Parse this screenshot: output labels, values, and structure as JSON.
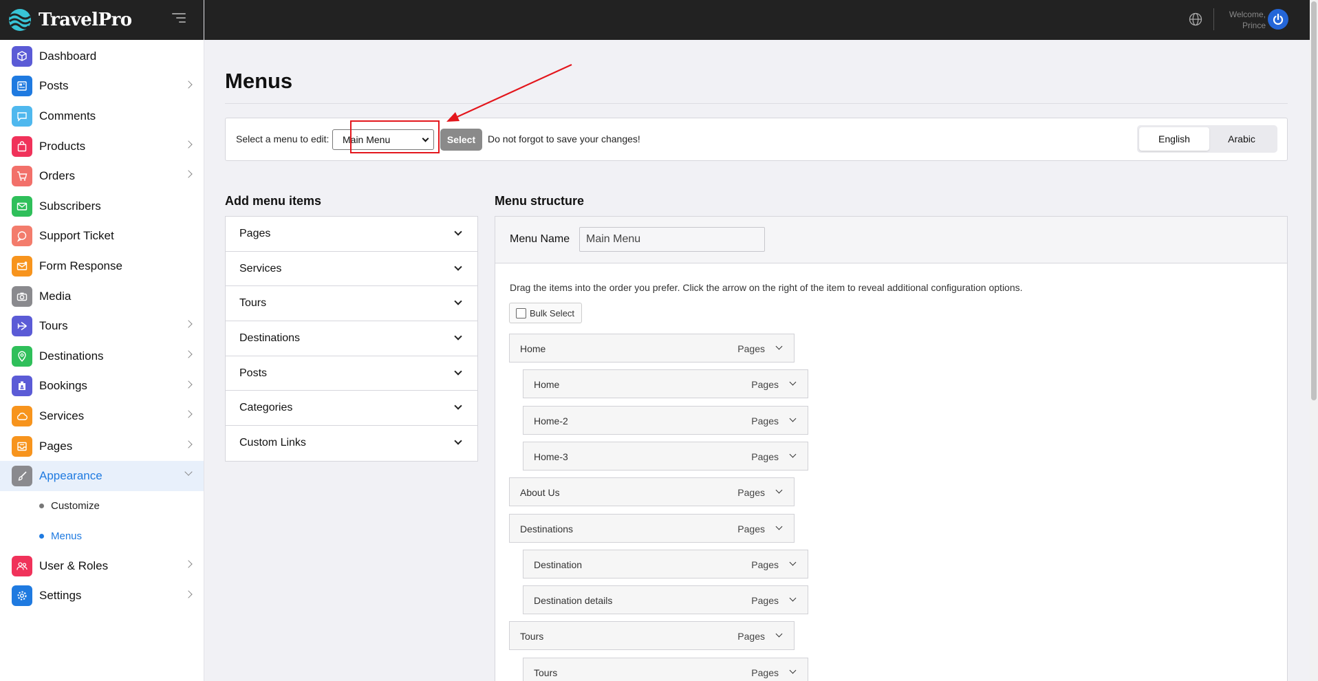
{
  "brand": {
    "name": "TravelPro"
  },
  "sidebar": {
    "items": [
      {
        "label": "Dashboard",
        "icon": "cube-icon",
        "color": "#5b5bd6",
        "chevron": false
      },
      {
        "label": "Posts",
        "icon": "newspaper-icon",
        "color": "#1f7ae0",
        "chevron": true
      },
      {
        "label": "Comments",
        "icon": "comment-icon",
        "color": "#4fb8ee",
        "chevron": false
      },
      {
        "label": "Products",
        "icon": "shopping-bag-icon",
        "color": "#f0325a",
        "chevron": true
      },
      {
        "label": "Orders",
        "icon": "cart-icon",
        "color": "#f2706a",
        "chevron": true
      },
      {
        "label": "Subscribers",
        "icon": "mail-icon",
        "color": "#2fbf5a",
        "chevron": false
      },
      {
        "label": "Support Ticket",
        "icon": "chat-bubble-icon",
        "color": "#f37c6c",
        "chevron": false
      },
      {
        "label": "Form Response",
        "icon": "envelope-icon",
        "color": "#f7941d",
        "chevron": false
      },
      {
        "label": "Media",
        "icon": "camera-icon",
        "color": "#8a8a8e",
        "chevron": false
      },
      {
        "label": "Tours",
        "icon": "plane-icon",
        "color": "#5b5bd6",
        "chevron": true
      },
      {
        "label": "Destinations",
        "icon": "map-pin-icon",
        "color": "#2fbf5a",
        "chevron": true
      },
      {
        "label": "Bookings",
        "icon": "booking-icon",
        "color": "#5b5bd6",
        "chevron": true
      },
      {
        "label": "Services",
        "icon": "cloud-icon",
        "color": "#f7941d",
        "chevron": true
      },
      {
        "label": "Pages",
        "icon": "inbox-icon",
        "color": "#f7941d",
        "chevron": true
      },
      {
        "label": "Appearance",
        "icon": "brush-icon",
        "color": "#8a8a8e",
        "chevron": true,
        "active": true
      },
      {
        "label": "User & Roles",
        "icon": "users-icon",
        "color": "#f0325a",
        "chevron": true
      },
      {
        "label": "Settings",
        "icon": "gear-icon",
        "color": "#1f7ae0",
        "chevron": true
      }
    ],
    "appearance_sub": [
      {
        "label": "Customize",
        "active": false
      },
      {
        "label": "Menus",
        "active": true
      }
    ]
  },
  "topbar": {
    "welcome": "Welcome,",
    "user": "Prince"
  },
  "page": {
    "title": "Menus"
  },
  "select_bar": {
    "label": "Select a menu to edit:",
    "selected_menu": "Main Menu",
    "select_button": "Select",
    "note": "Do not forgot to save your changes!",
    "languages": [
      "English",
      "Arabic"
    ],
    "active_language": "English"
  },
  "add_menu": {
    "title": "Add menu items",
    "sections": [
      "Pages",
      "Services",
      "Tours",
      "Destinations",
      "Posts",
      "Categories",
      "Custom Links"
    ]
  },
  "structure": {
    "title": "Menu structure",
    "menu_name_label": "Menu Name",
    "menu_name_value": "Main Menu",
    "instructions": "Drag the items into the order you prefer. Click the arrow on the right of the item to reveal additional configuration options.",
    "bulk_select": "Bulk Select",
    "items": [
      {
        "title": "Home",
        "type": "Pages",
        "depth": 0
      },
      {
        "title": "Home",
        "type": "Pages",
        "depth": 1
      },
      {
        "title": "Home-2",
        "type": "Pages",
        "depth": 1
      },
      {
        "title": "Home-3",
        "type": "Pages",
        "depth": 1
      },
      {
        "title": "About Us",
        "type": "Pages",
        "depth": 0
      },
      {
        "title": "Destinations",
        "type": "Pages",
        "depth": 0
      },
      {
        "title": "Destination",
        "type": "Pages",
        "depth": 1
      },
      {
        "title": "Destination details",
        "type": "Pages",
        "depth": 1
      },
      {
        "title": "Tours",
        "type": "Pages",
        "depth": 0
      },
      {
        "title": "Tours",
        "type": "Pages",
        "depth": 1
      }
    ]
  },
  "colors": {
    "accent": "#1f7ae0",
    "highlight": "#e3161c",
    "topbar": "#222222"
  }
}
